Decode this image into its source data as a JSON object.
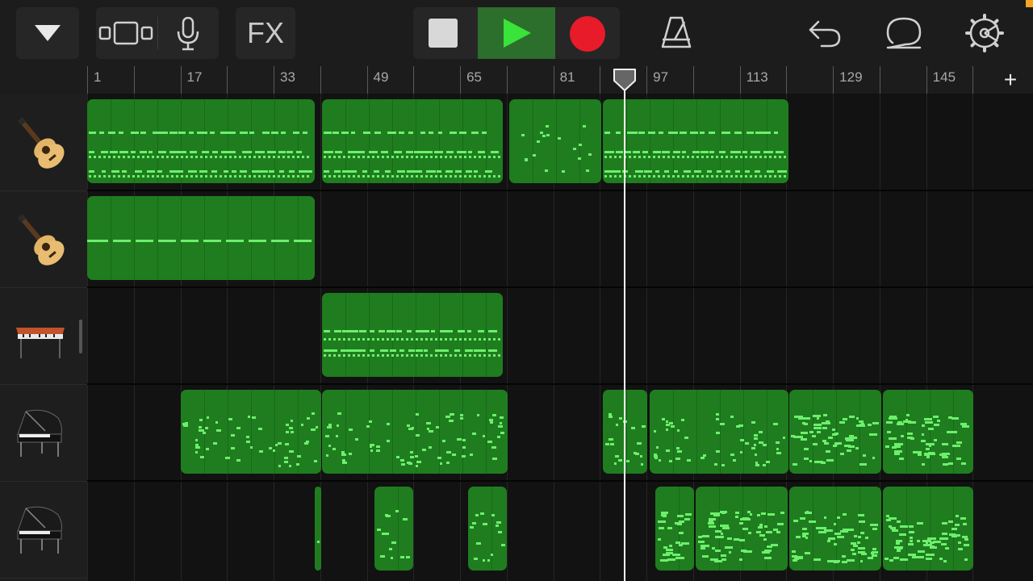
{
  "toolbar": {
    "fx_label": "FX"
  },
  "ruler": {
    "bar_numbers": [
      "1",
      "17",
      "33",
      "49",
      "65",
      "81",
      "97",
      "113",
      "129",
      "145"
    ]
  },
  "tracks": [
    {
      "instrument": "acoustic-guitar-icon"
    },
    {
      "instrument": "acoustic-guitar-icon"
    },
    {
      "instrument": "electric-piano-icon"
    },
    {
      "instrument": "grand-piano-icon"
    },
    {
      "instrument": "grand-piano-icon"
    }
  ],
  "colors": {
    "region_fill": "#1f7d1f",
    "note": "#6cf06c",
    "play_active": "#2c6e2c",
    "record": "#e81b2b",
    "playhead": "#ffffff"
  }
}
